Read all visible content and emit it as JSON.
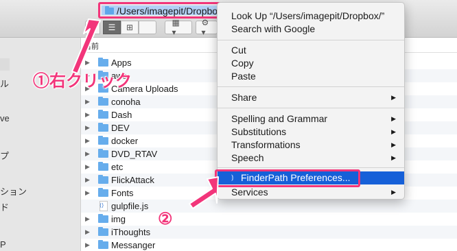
{
  "path_bar": {
    "text": "/Users/imagepit/Dropbox"
  },
  "toolbar": {
    "list_glyph": "☰",
    "column_glyph": "⊞",
    "grid_glyph": "▦ ▾",
    "gear_glyph": "⚙ ▾"
  },
  "sidebar": {
    "items": [
      "ル",
      "ve",
      "プ",
      "ション",
      "ド",
      "P"
    ]
  },
  "file_list": {
    "header": "名前",
    "rows": [
      {
        "name": "Apps",
        "type": "folder",
        "disclosure": "▶"
      },
      {
        "name": "aws",
        "type": "folder",
        "disclosure": "▶"
      },
      {
        "name": "Camera Uploads",
        "type": "folder",
        "disclosure": "▶"
      },
      {
        "name": "conoha",
        "type": "folder",
        "disclosure": "▶"
      },
      {
        "name": "Dash",
        "type": "folder",
        "disclosure": "▶"
      },
      {
        "name": "DEV",
        "type": "folder",
        "disclosure": "▶"
      },
      {
        "name": "docker",
        "type": "folder",
        "disclosure": "▶"
      },
      {
        "name": "DVD_RTAV",
        "type": "folder",
        "disclosure": "▶"
      },
      {
        "name": "etc",
        "type": "folder",
        "disclosure": "▶"
      },
      {
        "name": "FlickAttack",
        "type": "folder",
        "disclosure": "▶"
      },
      {
        "name": "Fonts",
        "type": "folder",
        "disclosure": "▶"
      },
      {
        "name": "gulpfile.js",
        "type": "file",
        "disclosure": ""
      },
      {
        "name": "img",
        "type": "folder",
        "disclosure": "▶"
      },
      {
        "name": "iThoughts",
        "type": "folder",
        "disclosure": "▶"
      },
      {
        "name": "Messanger",
        "type": "folder",
        "disclosure": "▶"
      }
    ]
  },
  "context_menu": {
    "lookup": "Look Up “/Users/imagepit/Dropbox/”",
    "search_google": "Search with Google",
    "cut": "Cut",
    "copy": "Copy",
    "paste": "Paste",
    "share": "Share",
    "spelling": "Spelling and Grammar",
    "substitutions": "Substitutions",
    "transformations": "Transformations",
    "speech": "Speech",
    "finderpath_prefs": "FinderPath Preferences...",
    "services": "Services",
    "submenu_arrow": "▶",
    "highlighted_icon": "⦆"
  },
  "annotations": {
    "step1": "①右クリック",
    "step2": "②",
    "color": "#f2357a"
  }
}
